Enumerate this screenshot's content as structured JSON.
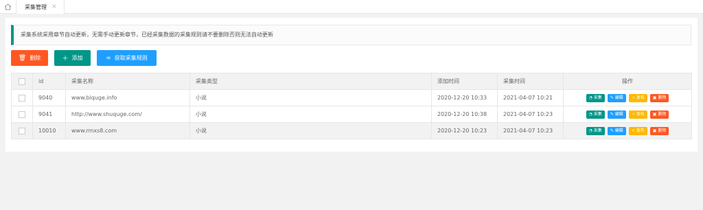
{
  "tabs": [
    {
      "label": "采集管理",
      "close": "×"
    }
  ],
  "icons": {
    "home": "home-icon",
    "trash": "trash-icon",
    "plus": "plus-icon",
    "link": "link-icon",
    "gauge": "gauge-icon",
    "pencil": "pencil-icon",
    "share": "share-icon"
  },
  "notice": "采集系统采用章节自动更新，无需手动更新章节，已经采集数据的采集规则请不要删除否则无法自动更新",
  "toolbar": {
    "delete_label": "删除",
    "add_label": "添加",
    "fetch_rules_label": "获取采集规则"
  },
  "table": {
    "headers": {
      "id": "id",
      "name": "采集名称",
      "type": "采集类型",
      "added": "添加时间",
      "collected": "采集时间",
      "actions": "操作"
    },
    "action_labels": {
      "collect": "采集",
      "edit": "编辑",
      "publish": "发布",
      "delete": "删除"
    },
    "rows": [
      {
        "id": "9040",
        "name": "www.biquge.info",
        "type": "小说",
        "added": "2020-12-20 10:33",
        "collected": "2021-04-07 10:21"
      },
      {
        "id": "9041",
        "name": "http://www.shuquge.com/",
        "type": "小说",
        "added": "2020-12-20 10:38",
        "collected": "2021-04-07 10:23"
      },
      {
        "id": "10010",
        "name": "www.rmxs8.com",
        "type": "小说",
        "added": "2020-12-20 10:23",
        "collected": "2021-04-07 10:23"
      }
    ]
  },
  "colors": {
    "primary": "#009688",
    "danger": "#ff5722",
    "info": "#1e9fff",
    "warn": "#ffb800"
  }
}
